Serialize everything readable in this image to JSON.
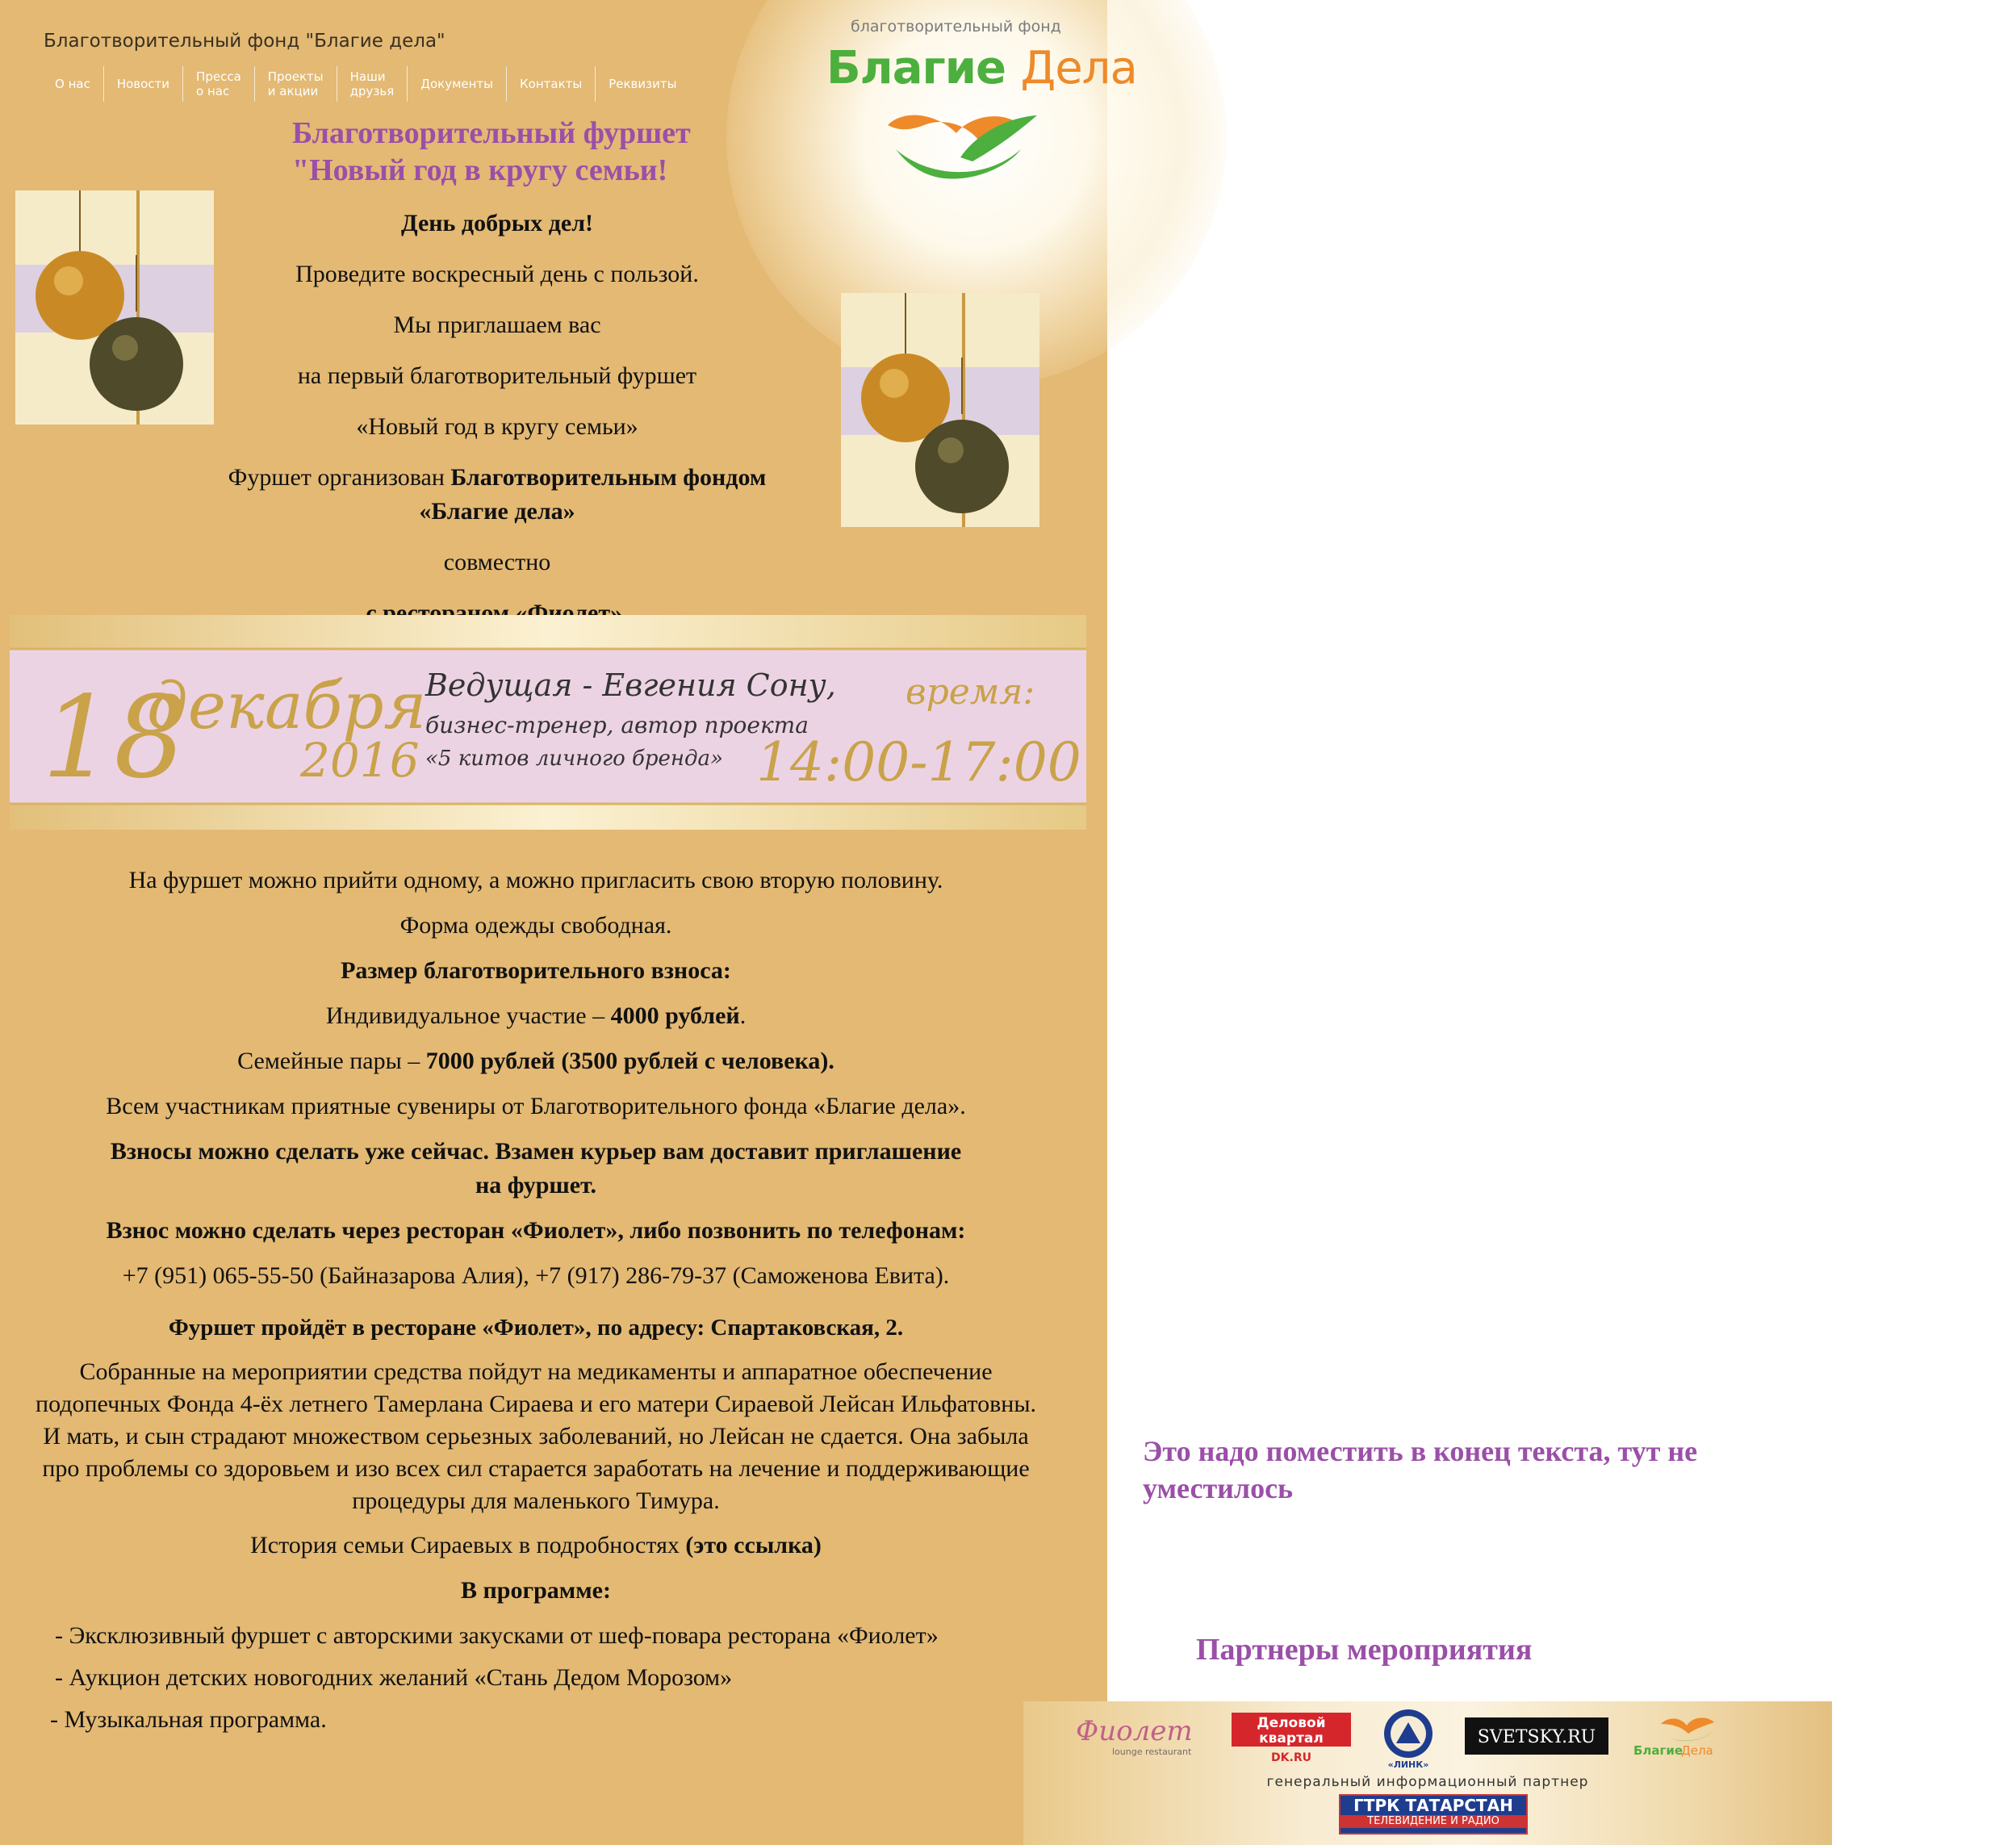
{
  "site": {
    "title": "Благотворительный фонд \"Благие дела\"",
    "nav": [
      "О нас",
      "Новости",
      "Пресса\nо нас",
      "Проекты\nи акции",
      "Наши\nдрузья",
      "Документы",
      "Контакты",
      "Реквизиты"
    ],
    "logo": {
      "subtitle": "благотворительный фонд",
      "name_green": "Благие",
      "name_orange": "Дела",
      "colors": {
        "green": "#4caf3e",
        "orange": "#ee8a2a"
      }
    }
  },
  "event": {
    "title_line1": "Благотворительный фуршет",
    "title_line2": "\"Новый год в кругу семьи!",
    "intro": {
      "headline": "День добрых дел!",
      "line1": "Проведите воскресный день с пользой.",
      "line2": "Мы приглашаем вас",
      "line3": "на первый благотворительный фуршет",
      "line4": "«Новый год в кругу семьи»",
      "organized_prefix": "Фуршет организован ",
      "organized_bold": "Благотворительным фондом «Благие дела»",
      "together": "совместно",
      "restaurant": "с рестораном «Фиолет»."
    },
    "banner": {
      "day": "18",
      "month": "декабря",
      "year": "2016",
      "host_line1": "Ведущая - Евгения Сону,",
      "host_line2": "бизнес-тренер, автор проекта",
      "host_line3": "«5 китов личного бренда»",
      "time_label": "время:",
      "time": "14:00-17:00"
    },
    "details": {
      "p1": "На фуршет можно прийти одному, а можно пригласить свою вторую половину.",
      "p2": "Форма одежды свободная.",
      "fee_title": "Размер благотворительного взноса:",
      "individual_prefix": "Индивидуальное участие – ",
      "individual_value": "4000 рублей",
      "individual_suffix": ".",
      "couples_prefix": "Семейные пары – ",
      "couples_value": "7000 рублей (3500 рублей с человека).",
      "souvenirs": "Всем участникам приятные сувениры от Благотворительного фонда «Благие дела».",
      "courier": "Взносы можно сделать уже сейчас. Взамен курьер вам доставит приглашение на фуршет.",
      "phone_note": "Взнос можно сделать через ресторан «Фиолет», либо позвонить по телефонам:",
      "phones": "+7 (951) 065-55-50 (Байназарова Алия), +7 (917) 286-79-37 (Саможенова Евита).",
      "venue": "Фуршет пройдёт в ресторане «Фиолет», по адресу: Спартаковская, 2.",
      "funds": "Собранные на мероприятии средства пойдут на медикаменты и аппаратное обеспечение подопечных Фонда 4-ёх летнего Тамерлана Сираева и его матери Сираевой Лейсан Ильфатовны. И мать, и сын страдают множеством серьезных заболеваний, но Лейсан не сдается. Она забыла про проблемы со здоровьем и изо всех сил старается заработать на лечение и поддерживающие процедуры для маленького Тимура.",
      "history_text": "История семьи Сираевых в подробностях ",
      "history_link": "(это ссылка)",
      "program_title": "В программе:",
      "program": [
        "- Эксклюзивный фуршет с авторскими закусками от шеф-повара ресторана «Фиолет»",
        "- Аукцион детских новогодних желаний «Стань Дедом Морозом»",
        "- Музыкальная программа."
      ]
    }
  },
  "side_note": "Это надо поместить в конец текста, тут не уместилось",
  "partners": {
    "title": "Партнеры мероприятия",
    "logos": {
      "fiolet": "Фиолет",
      "fiolet_sub": "lounge restaurant",
      "dk_line1": "Деловой",
      "dk_line2": "квартал",
      "dk_site": "DK.RU",
      "links": "«ЛИНК»",
      "svetsky": "SVETSKY.RU",
      "blagie_green": "Благие",
      "blagie_orange": "Дела"
    },
    "general_partner": "генеральный информационный партнер",
    "gtrk_line1": "ГТРК ТАТАРСТАН",
    "gtrk_line2": "ТЕЛЕВИДЕНИЕ И РАДИО"
  },
  "colors": {
    "background_panel": "#e3b974",
    "accent_purple": "#9b4fa8",
    "banner_pink": "#ecd3e3"
  }
}
